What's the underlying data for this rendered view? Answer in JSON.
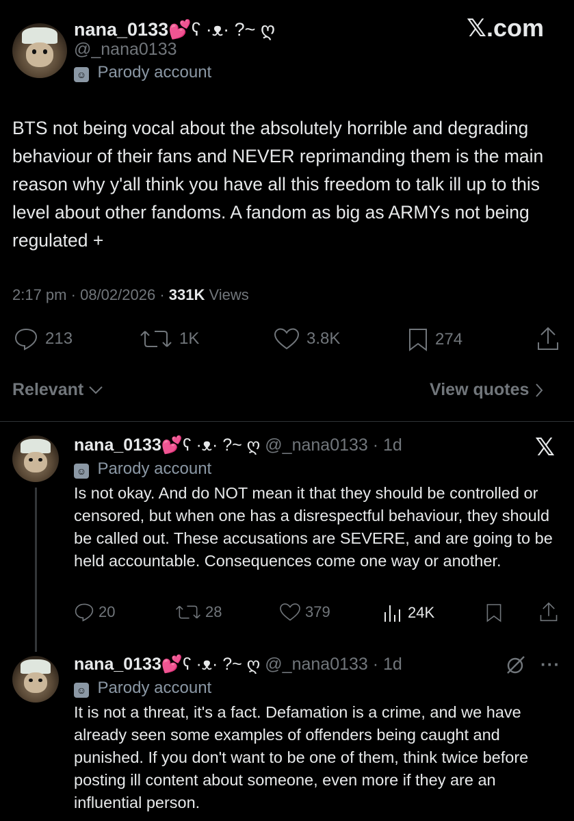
{
  "main_tweet": {
    "display_name": "nana_0133",
    "name_emoji": "💕",
    "name_suffix": "ʕ ·ᴥ· ?~ ღ",
    "handle": "@_nana0133",
    "badge_label": "Parody account",
    "text": "BTS not being vocal about the absolutely horrible and degrading behaviour of their fans and NEVER reprimanding them is the main reason why y'all think you have all this freedom to talk ill up to this level about other fandoms. A fandom as big as ARMYs not being regulated +",
    "time": "2:17 pm",
    "date": "08/02/2026",
    "views_count": "331K",
    "views_label": "Views",
    "replies": "213",
    "reposts": "1K",
    "likes": "3.8K",
    "bookmarks": "274"
  },
  "watermark_text": "𝕏.com",
  "sort": {
    "label": "Relevant",
    "view_quotes": "View quotes"
  },
  "reply1": {
    "display_name": "nana_0133",
    "name_emoji": "💕",
    "name_suffix": "ʕ ·ᴥ· ?~ ღ",
    "handle": "@_nana0133",
    "time": "1d",
    "badge_label": "Parody account",
    "text": "Is not okay. And do NOT mean it that they should be controlled or censored, but when one has a disrespectful behaviour, they should be called out. These accusations are SEVERE, and are going to be held accountable. Consequences come one way or another.",
    "replies": "20",
    "reposts": "28",
    "likes": "379",
    "views": "24K"
  },
  "reply2": {
    "display_name": "nana_0133",
    "name_emoji": "💕",
    "name_suffix": "ʕ ·ᴥ· ?~ ღ",
    "handle": "@_nana0133",
    "time": "1d",
    "badge_label": "Parody account",
    "text": "It is not a threat, it's a fact. Defamation is a crime, and we have already seen some examples of offenders being caught and punished. If you don't want to be one of them, think twice before posting ill content about someone, even more if they are an influential person."
  },
  "colors": {
    "background": "#000000",
    "text": "#e7e9ea",
    "muted": "#71767b",
    "badge": "#8b98a5"
  },
  "icons": [
    "reply-icon",
    "repost-icon",
    "like-icon",
    "bookmark-icon",
    "share-icon",
    "views-icon",
    "x-logo-icon",
    "grok-icon",
    "more-icon",
    "chevron-down-icon",
    "chevron-right-icon",
    "parody-mask-icon"
  ]
}
